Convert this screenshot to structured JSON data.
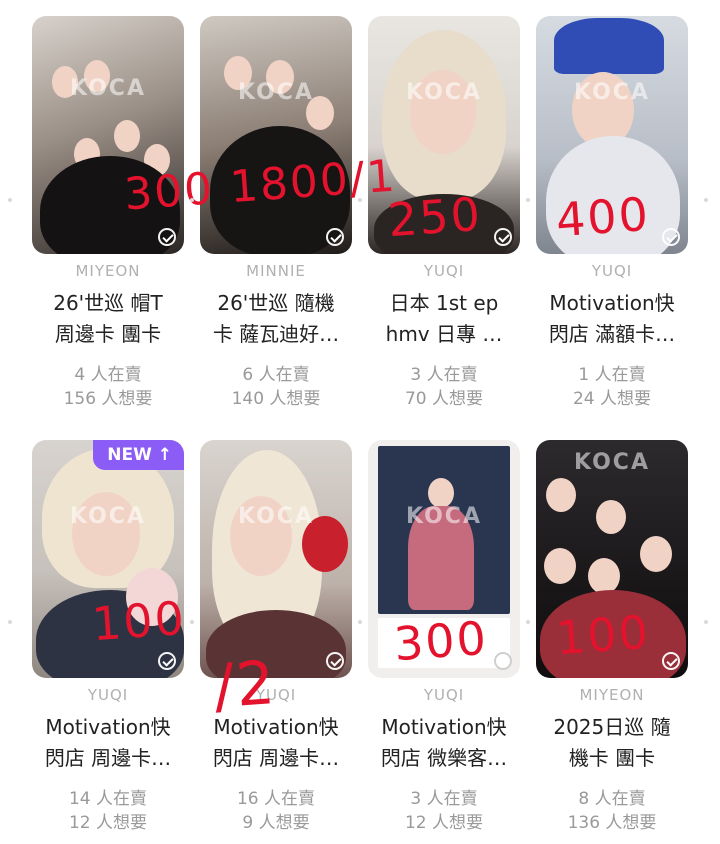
{
  "watermark": "KOCA",
  "cards": [
    {
      "member": "MIYEON",
      "title": [
        "26'世巡 帽T",
        "周邊卡 團卡"
      ],
      "selling": "4 人在賣",
      "wanted": "156 人想要",
      "overlay": "300 1800/1",
      "badge": ""
    },
    {
      "member": "MINNIE",
      "title": [
        "26'世巡 隨機",
        "卡 薩瓦迪好…"
      ],
      "selling": "6 人在賣",
      "wanted": "140 人想要",
      "overlay": "",
      "badge": ""
    },
    {
      "member": "YUQI",
      "title": [
        "日本 1st ep",
        "hmv 日專 …"
      ],
      "selling": "3 人在賣",
      "wanted": "70 人想要",
      "overlay": "250",
      "badge": ""
    },
    {
      "member": "YUQI",
      "title": [
        "Motivation快",
        "閃店 滿額卡…"
      ],
      "selling": "1 人在賣",
      "wanted": "24 人想要",
      "overlay": "400",
      "badge": ""
    },
    {
      "member": "YUQI",
      "title": [
        "Motivation快",
        "閃店 周邊卡…"
      ],
      "selling": "14 人在賣",
      "wanted": "12 人想要",
      "overlay": "100",
      "badge": "NEW ↑"
    },
    {
      "member": "YUQI",
      "title": [
        "Motivation快",
        "閃店 周邊卡…"
      ],
      "selling": "16 人在賣",
      "wanted": "9 人想要",
      "overlay": "/2",
      "badge": ""
    },
    {
      "member": "YUQI",
      "title": [
        "Motivation快",
        "閃店 微樂客…"
      ],
      "selling": "3 人在賣",
      "wanted": "12 人想要",
      "overlay": "300",
      "badge": ""
    },
    {
      "member": "MIYEON",
      "title": [
        "2025日巡 隨",
        "機卡 團卡"
      ],
      "selling": "8 人在賣",
      "wanted": "136 人想要",
      "overlay": "100",
      "badge": ""
    }
  ],
  "colors": {
    "overlay_red": "#e3122d",
    "badge_purple": "#8b5cf6"
  },
  "icons": [
    "check-circle-icon",
    "arrow-up-icon"
  ]
}
